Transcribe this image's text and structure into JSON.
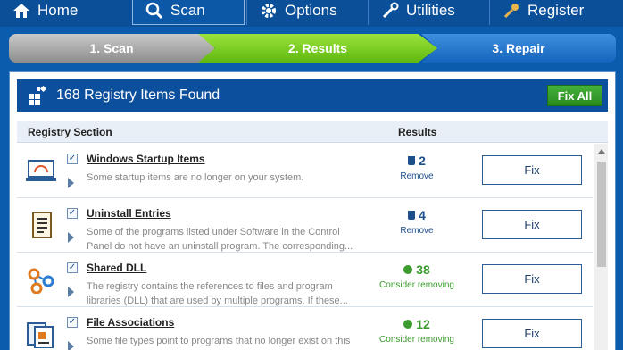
{
  "nav": {
    "home": "Home",
    "scan": "Scan",
    "options": "Options",
    "utilities": "Utilities",
    "register": "Register"
  },
  "steps": [
    "1. Scan",
    "2. Results",
    "3. Repair"
  ],
  "panel": {
    "title": "168 Registry Items Found",
    "fix_all": "Fix All",
    "col_section": "Registry Section",
    "col_results": "Results"
  },
  "rows": [
    {
      "name": "Windows Startup Items",
      "desc": "Some startup items are no longer on your system.",
      "count": "2",
      "action": "Remove",
      "severity": "remove",
      "fix": "Fix"
    },
    {
      "name": "Uninstall Entries",
      "desc": "Some of the programs listed under Software in the Control Panel do not have an uninstall program. The corresponding...",
      "count": "4",
      "action": "Remove",
      "severity": "remove",
      "fix": "Fix"
    },
    {
      "name": "Shared DLL",
      "desc": "The registry contains the references to files and program libraries (DLL) that are used by multiple programs. If these...",
      "count": "38",
      "action": "Consider removing",
      "severity": "consider",
      "fix": "Fix"
    },
    {
      "name": "File Associations",
      "desc": "Some file types point to programs that no longer exist on this",
      "count": "12",
      "action": "Consider removing",
      "severity": "consider",
      "fix": "Fix"
    }
  ],
  "colors": {
    "accent": "#0b5cad",
    "green": "#3b9b2e",
    "blue": "#1d4f8d"
  }
}
